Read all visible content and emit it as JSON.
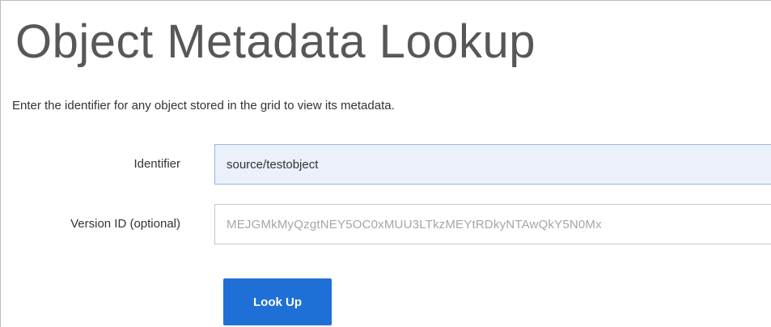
{
  "page": {
    "title": "Object Metadata Lookup",
    "description": "Enter the identifier for any object stored in the grid to view its metadata."
  },
  "form": {
    "identifier": {
      "label": "Identifier",
      "value": "source/testobject"
    },
    "version_id": {
      "label": "Version ID (optional)",
      "placeholder": "MEJGMkMyQzgtNEY5OC0xMUU3LTkzMEYtRDkyNTAwQkY5N0Mx",
      "value": ""
    },
    "lookup_button": {
      "label": "Look Up"
    }
  },
  "colors": {
    "primary_button": "#1f70d6",
    "focused_input_bg": "#eaf1fb"
  }
}
